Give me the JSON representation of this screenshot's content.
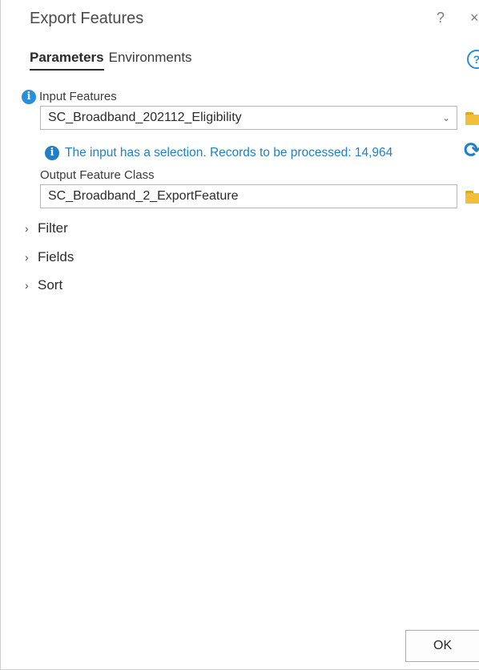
{
  "header": {
    "title": "Export Features",
    "help_glyph": "?",
    "close_glyph": "×"
  },
  "tabs": [
    {
      "label": "Parameters",
      "active": true
    },
    {
      "label": "Environments",
      "active": false
    }
  ],
  "tab_help_glyph": "?",
  "params": {
    "input_features": {
      "label": "Input Features",
      "value": "SC_Broadband_202112_Eligibility",
      "dropdown_glyph": "⌄"
    },
    "selection_message": "The input has a selection. Records to be processed: 14,964",
    "refresh_glyph": "⟳",
    "output_feature_class": {
      "label": "Output Feature Class",
      "value": "SC_Broadband_2_ExportFeature"
    }
  },
  "sections": [
    {
      "label": "Filter",
      "chevron": "›"
    },
    {
      "label": "Fields",
      "chevron": "›"
    },
    {
      "label": "Sort",
      "chevron": "›"
    }
  ],
  "footer": {
    "ok_label": "OK"
  },
  "icons": {
    "info": "info-icon",
    "folder": "folder-icon",
    "refresh": "refresh-icon",
    "help": "help-icon",
    "close": "close-icon"
  },
  "colors": {
    "accent_blue": "#1f7fc8",
    "folder_yellow": "#f2bf3a"
  }
}
